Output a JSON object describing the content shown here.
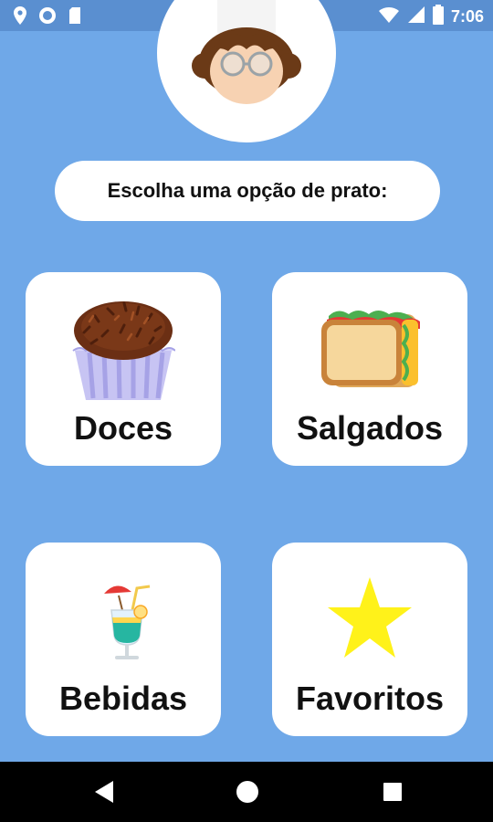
{
  "status_bar": {
    "time": "7:06",
    "left_icons": [
      "location-icon",
      "circle-icon",
      "sim-card-icon"
    ],
    "right_icons": [
      "wifi-icon",
      "signal-icon",
      "battery-icon"
    ]
  },
  "prompt": {
    "text": "Escolha uma opção de prato:"
  },
  "categories": [
    {
      "label": "Doces",
      "icon": "brigadeiro-icon"
    },
    {
      "label": "Salgados",
      "icon": "sandwich-icon"
    },
    {
      "label": "Bebidas",
      "icon": "cocktail-icon"
    },
    {
      "label": "Favoritos",
      "icon": "star-icon"
    }
  ],
  "nav_bar": {
    "buttons": [
      "back-icon",
      "home-icon",
      "recents-icon"
    ]
  },
  "colors": {
    "background": "#6fa8e8",
    "status_bar": "#5a8fd0",
    "card": "#ffffff",
    "star": "#fff21a"
  }
}
